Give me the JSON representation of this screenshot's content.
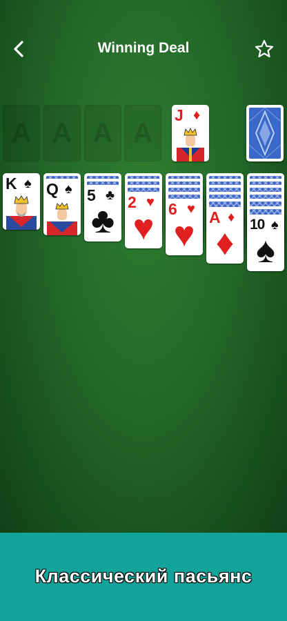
{
  "header": {
    "title": "Winning Deal",
    "back_icon": "chevron-left-icon",
    "favorite_icon": "star-outline-icon"
  },
  "foundations": [
    {
      "label": "A"
    },
    {
      "label": "A"
    },
    {
      "label": "A"
    },
    {
      "label": "A"
    }
  ],
  "waste": {
    "rank": "J",
    "suit": "♦",
    "color": "red"
  },
  "stock": {
    "face": "down"
  },
  "tableau": [
    {
      "face_down": 0,
      "top": {
        "rank": "K",
        "suit": "♠",
        "color": "black"
      }
    },
    {
      "face_down": 1,
      "top": {
        "rank": "Q",
        "suit": "♠",
        "color": "black"
      }
    },
    {
      "face_down": 2,
      "top": {
        "rank": "5",
        "suit": "♣",
        "color": "black"
      }
    },
    {
      "face_down": 3,
      "top": {
        "rank": "2",
        "suit": "♥",
        "color": "red"
      }
    },
    {
      "face_down": 4,
      "top": {
        "rank": "6",
        "suit": "♥",
        "color": "red"
      }
    },
    {
      "face_down": 5,
      "top": {
        "rank": "A",
        "suit": "♦",
        "color": "red"
      }
    },
    {
      "face_down": 6,
      "top": {
        "rank": "10",
        "suit": "♠",
        "color": "black"
      }
    }
  ],
  "colors": {
    "felt": "#23682a",
    "banner": "#12a39b",
    "card_back": "#3d66c9",
    "red_suit": "#e02020"
  },
  "banner": {
    "text": "Классический пасьянс"
  }
}
